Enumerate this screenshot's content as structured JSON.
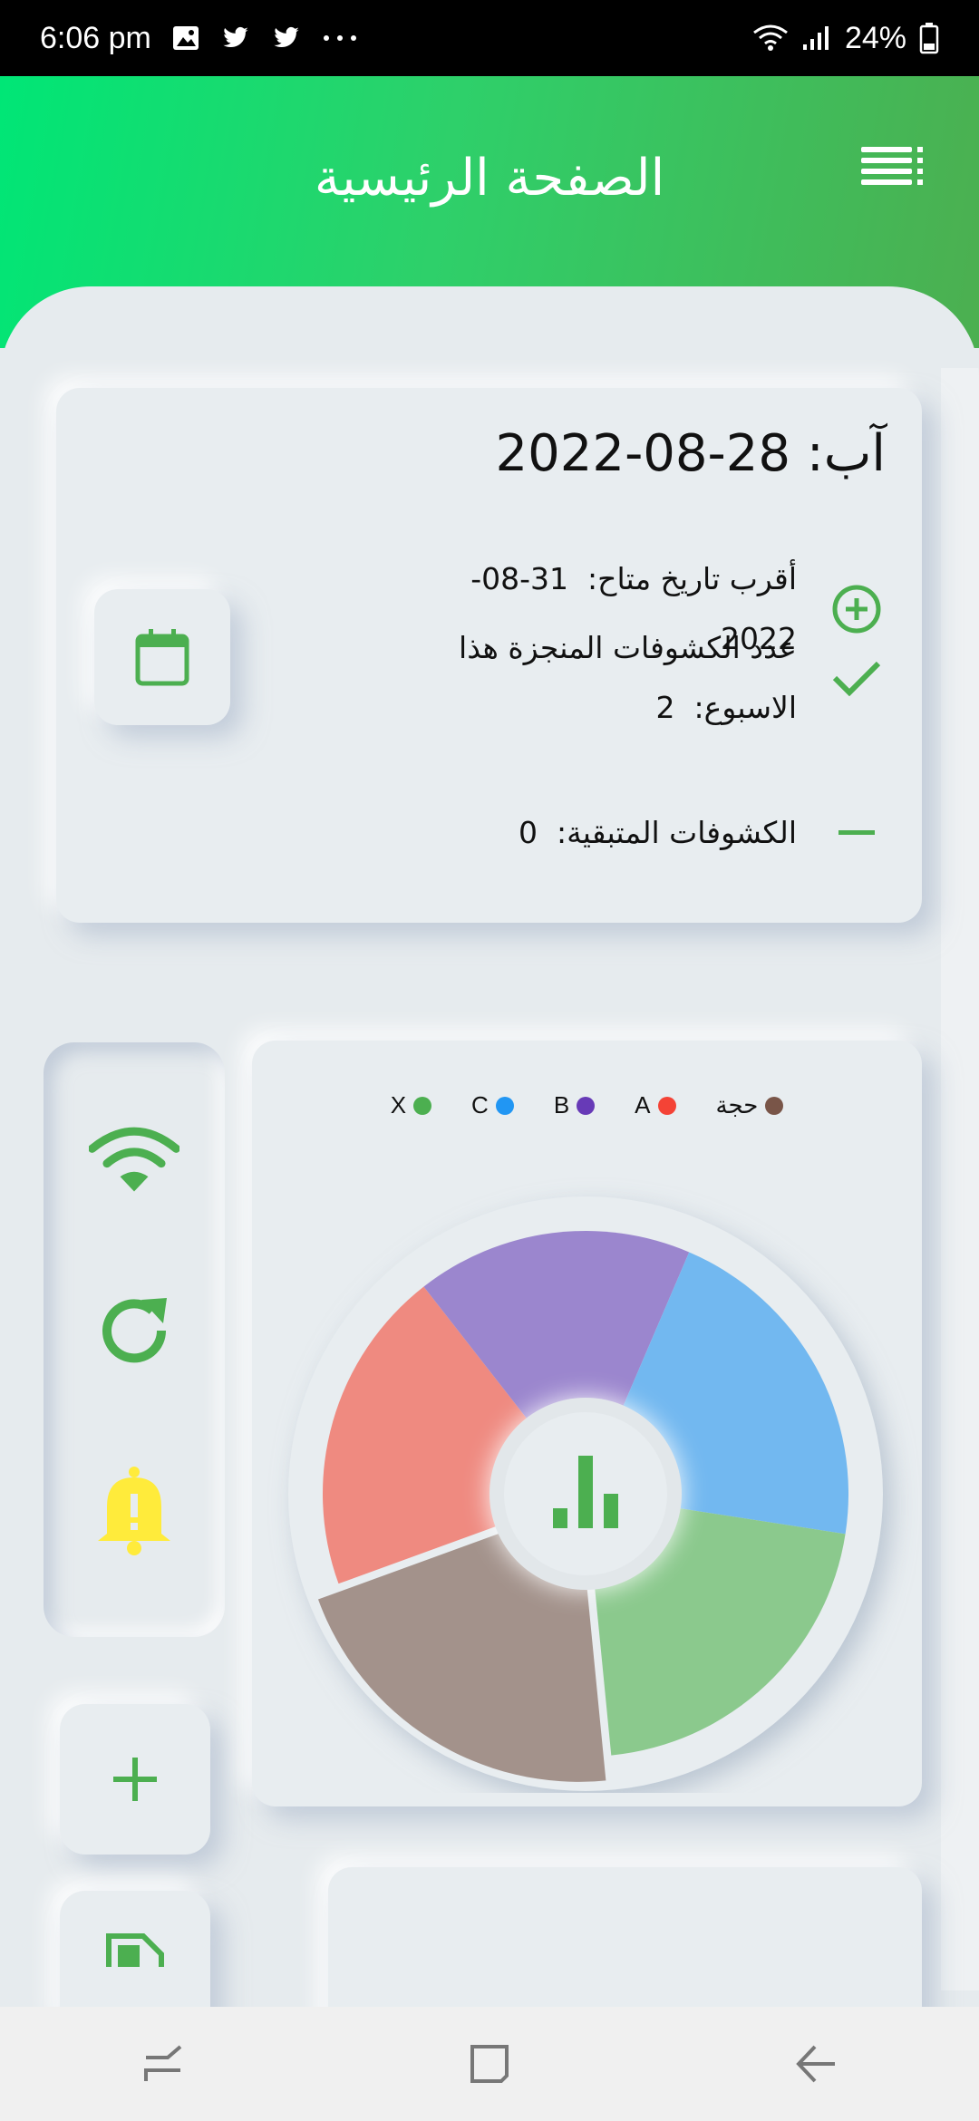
{
  "status_bar": {
    "time": "6:06 pm",
    "battery": "24%"
  },
  "header": {
    "title": "الصفحة الرئيسية"
  },
  "summary": {
    "due_label": "آب:",
    "due_date": "28-08-2022",
    "next_available_label": "أقرب تاريخ متاح:",
    "next_available_value": "31-08-2022",
    "week_done_label": "عدد الكشوفات المنجزة هذا الاسبوع:",
    "week_done_value": "2",
    "remaining_label": "الكشوفات المتبقية:",
    "remaining_value": "0"
  },
  "colors": {
    "accent": "#4caf50",
    "bell": "#ffeb3b",
    "header_start": "#00e676",
    "header_end": "#4caf50"
  },
  "chart_data": {
    "type": "pie",
    "legend": [
      {
        "label": "حجة",
        "color": "#795548"
      },
      {
        "label": "A",
        "color": "#f44336"
      },
      {
        "label": "B",
        "color": "#673ab7"
      },
      {
        "label": "C",
        "color": "#2196f3"
      },
      {
        "label": "X",
        "color": "#4caf50"
      }
    ],
    "slices": [
      {
        "label": "A",
        "value": 20,
        "color": "#ef8a80"
      },
      {
        "label": "B",
        "value": 17,
        "color": "#9b86ce"
      },
      {
        "label": "C",
        "value": 21,
        "color": "#72b8f0"
      },
      {
        "label": "X",
        "value": 21,
        "color": "#8bc98d"
      },
      {
        "label": "حجة",
        "value": 21,
        "color": "#a3928b"
      }
    ],
    "center_icon": "bar-chart-icon"
  },
  "icons": {
    "menu": "menu-icon",
    "calendar": "calendar-icon",
    "wifi": "wifi-icon",
    "refresh": "refresh-icon",
    "bell": "bell-icon",
    "add": "plus-icon",
    "document": "document-icon"
  }
}
